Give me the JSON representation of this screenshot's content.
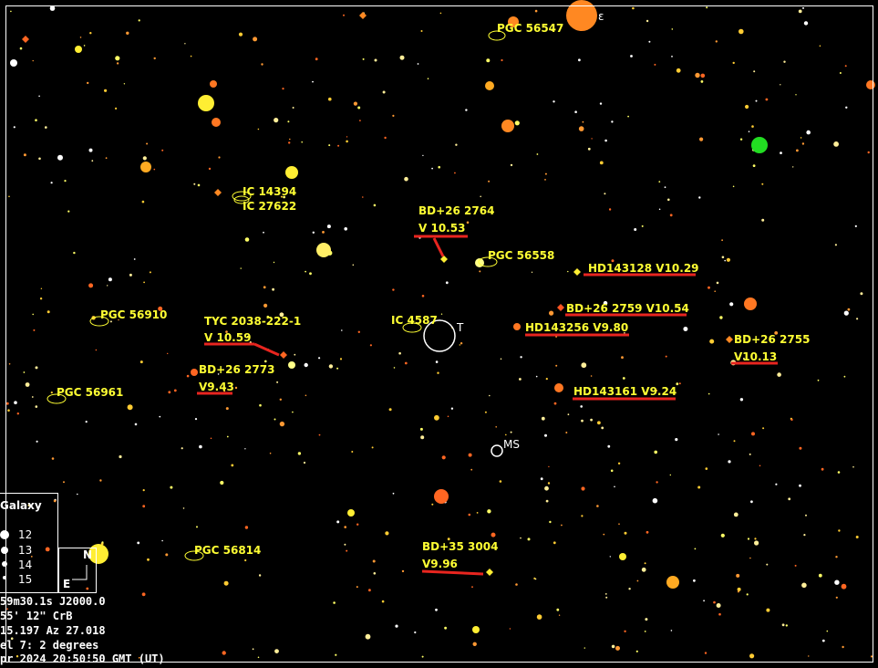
{
  "colors": {
    "background": "#000000",
    "label": "#ffff33",
    "underline": "#e8251f",
    "frame": "#ffffff"
  },
  "objects": [
    {
      "id": "pgc56547",
      "label": "PGC 56547"
    },
    {
      "id": "ic14394",
      "label": "IC 14394"
    },
    {
      "id": "ic27622",
      "label": "IC 27622"
    },
    {
      "id": "bd262764",
      "label": "BD+26 2764",
      "mag": "V 10.53"
    },
    {
      "id": "pgc56558",
      "label": "PGC 56558"
    },
    {
      "id": "hd143128",
      "label": "HD143128 V10.29"
    },
    {
      "id": "bd262759",
      "label": "BD+26 2759  V10.54"
    },
    {
      "id": "pgc56910",
      "label": "PGC 56910"
    },
    {
      "id": "tyc",
      "label": "TYC 2038-222-1",
      "mag": "V 10.59"
    },
    {
      "id": "ic4587",
      "label": "IC 4587"
    },
    {
      "id": "target",
      "label": "T"
    },
    {
      "id": "hd143256",
      "label": "HD143256  V9.80"
    },
    {
      "id": "bd262755",
      "label": "BD+26 2755",
      "mag": "V10.13"
    },
    {
      "id": "bd262773",
      "label": "BD+26 2773",
      "mag": "V9.43"
    },
    {
      "id": "pgc56961",
      "label": "PGC 56961"
    },
    {
      "id": "hd143161",
      "label": "HD143161 V9.24"
    },
    {
      "id": "ms",
      "label": "MS"
    },
    {
      "id": "pgc56814",
      "label": "PGC 56814"
    },
    {
      "id": "bd353004",
      "label": "BD+35 3004",
      "mag": "V9.96"
    },
    {
      "id": "epsilon",
      "label": "ε"
    }
  ],
  "legend": {
    "title": "Galaxy",
    "magnitudes": [
      "12",
      "13",
      "14",
      "15"
    ]
  },
  "compass": {
    "north": "N",
    "east": "E"
  },
  "info": {
    "line1": "59m30.1s  J2000.0",
    "line2": "55' 12\"    CrB",
    "line3": "15.197  Az 27.018",
    "line4": "el 7: 2 degrees",
    "line5": "pr 2024 20:50:50  GMT (UT)"
  }
}
